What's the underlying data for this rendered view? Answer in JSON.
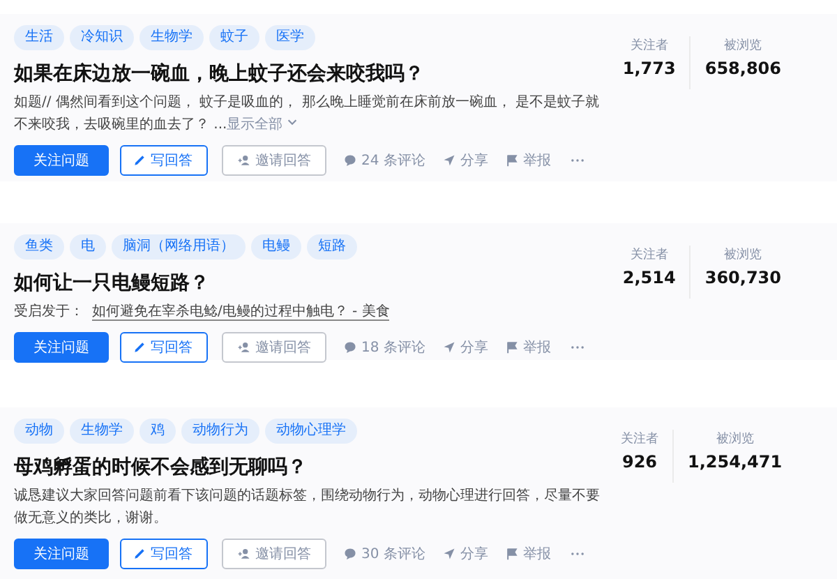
{
  "questions": [
    {
      "tags": [
        "生活",
        "冷知识",
        "生物学",
        "蚊子",
        "医学"
      ],
      "title": "如果在床边放一碗血，晚上蚊子还会来咬我吗？",
      "description": {
        "kind": "excerpt",
        "text": "如题// 偶然间看到这个问题， 蚊子是吸血的， 那么晚上睡觉前在床前放一碗血， 是不是蚊子就不来咬我，去吸碗里的血去了？ ...",
        "link": "显示全部"
      },
      "stats": [
        {
          "label": "关注者",
          "value": "1,773"
        },
        {
          "label": "被浏览",
          "value": "658,806"
        }
      ],
      "follow": "关注问题",
      "write": "写回答",
      "invite": "邀请回答",
      "comments": "24 条评论",
      "share": "分享",
      "report": "举报"
    },
    {
      "tags": [
        "鱼类",
        "电",
        "脑洞（网络用语）",
        "电鳗",
        "短路"
      ],
      "title": "如何让一只电鳗短路？",
      "description": {
        "kind": "inspired",
        "text": "受启发于：",
        "link": "如何避免在宰杀电鲶/电鳗的过程中触电？ - 美食"
      },
      "stats": [
        {
          "label": "关注者",
          "value": "2,514"
        },
        {
          "label": "被浏览",
          "value": "360,730"
        }
      ],
      "follow": "关注问题",
      "write": "写回答",
      "invite": "邀请回答",
      "comments": "18 条评论",
      "share": "分享",
      "report": "举报"
    },
    {
      "tags": [
        "动物",
        "生物学",
        "鸡",
        "动物行为",
        "动物心理学"
      ],
      "title": "母鸡孵蛋的时候不会感到无聊吗？",
      "description": {
        "kind": "plain",
        "text": "诚恳建议大家回答问题前看下该问题的话题标签，围绕动物行为，动物心理进行回答，尽量不要做无意义的类比，谢谢。"
      },
      "stats": [
        {
          "label": "关注者",
          "value": "926"
        },
        {
          "label": "被浏览",
          "value": "1,254,471"
        }
      ],
      "follow": "关注问题",
      "write": "写回答",
      "invite": "邀请回答",
      "comments": "30 条评论",
      "share": "分享",
      "report": "举报"
    }
  ]
}
